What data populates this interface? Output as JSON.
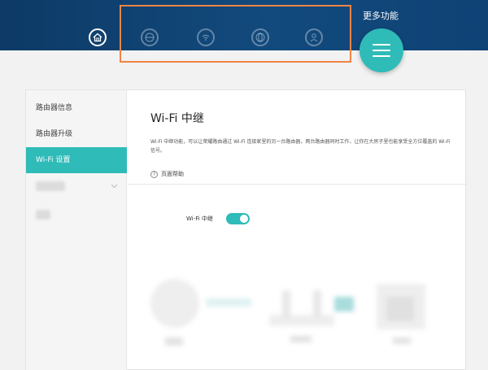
{
  "header": {
    "more_label": "更多功能",
    "nav_icons": [
      "home-icon",
      "globe-icon",
      "wifi-icon",
      "globe-alt-icon",
      "user-icon"
    ]
  },
  "sidebar": {
    "items": [
      {
        "label": "路由器信息"
      },
      {
        "label": "路由器升级"
      },
      {
        "label": "Wi-Fi 设置",
        "active": true
      }
    ]
  },
  "main": {
    "title": "Wi-Fi 中继",
    "description": "Wi-Fi 中继功能，可以让荣耀路由通过 Wi-Fi 连接家里的另一台路由器，两台路由器同时工作，让你在大房子里也能享受全方位覆盖的 Wi-Fi 信号。",
    "help_label": "页面帮助",
    "toggle_label": "Wi-Fi 中继",
    "toggle_on": true
  },
  "colors": {
    "accent": "#2fbbb8",
    "header": "#124a7d",
    "highlight": "#f08445"
  }
}
